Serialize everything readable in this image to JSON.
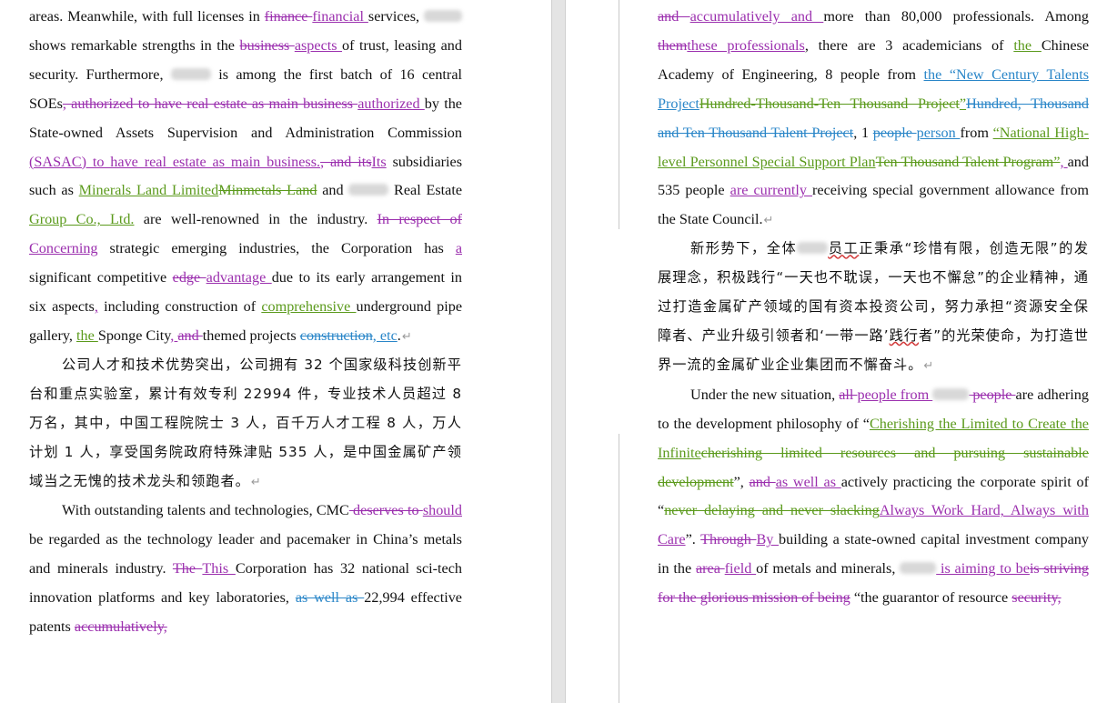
{
  "left": {
    "p1": {
      "s1": "areas. Meanwhile, with full licenses in ",
      "del1": "finance ",
      "ins1": "financial ",
      "s2": "services, ",
      "s3": " shows remarkable strengths in the ",
      "del2": "business ",
      "ins2": "aspects ",
      "s4": "of trust, leasing and security. Furthermore, ",
      "s5": " is among the first batch of 16 central SOEs",
      "del3": ", authorized to have real estate as main business ",
      "ins3": "authorized ",
      "s6": "by the State-owned Assets Supervision and Administration Commission",
      "ins4": " (SASAC) to have real estate as main business.",
      "del4": ", and its",
      "ins5": "Its",
      "s7": " subsidiaries such as ",
      "ins6": "Minerals Land Limited",
      "del5": "Minmetals Land",
      "s8": " and ",
      "s9": " Real Estate ",
      "ins7": "Group Co., Ltd.",
      "s10": " are well-renowned in the industry. ",
      "del6": "In respect of ",
      "ins8": "Concerning",
      "s11": " strategic emerging industries, the Corporation has ",
      "ins9": "a ",
      "s12": "significant competitive ",
      "del7": "edge ",
      "ins10": "advantage ",
      "s13": "due to its early arrangement in six aspects",
      "ins11": ",",
      "s14": " including construction of ",
      "ins12": "comprehensive ",
      "s15": "underground pipe gallery, ",
      "ins13": "the ",
      "s16": " Sponge City",
      "ins14": ", ",
      "del8": " and ",
      "s17": "themed projects ",
      "del9": "construction",
      "ins15": ", etc",
      "s18": "."
    },
    "p2": "公司人才和技术优势突出，公司拥有 32 个国家级科技创新平台和重点实验室，累计有效专利 22994 件，专业技术人员超过 8 万名，其中，中国工程院院士 3 人，百千万人才工程 8 人，万人计划 1 人，享受国务院政府特殊津贴 535 人，是中国金属矿产领域当之无愧的技术龙头和领跑者。",
    "p3": {
      "s1": "With outstanding talents and technologies, CMC",
      "del1": " deserves to ",
      "ins1": " should ",
      "s2": "be regarded as the technology leader and pacemaker in China’s metals and minerals industry. ",
      "del2": "The ",
      "ins2": "This ",
      "s3": "Corporation has 32 national sci-tech innovation platforms and key laboratories, ",
      "del3": "as well as ",
      "s4": "22,994 effective patents ",
      "del4": "accumulatively, "
    }
  },
  "right": {
    "p1": {
      "del1": "and ",
      "ins1": "accumulatively and ",
      "s1": "more than 80,000 professionals. Among ",
      "del2": "them",
      "ins2": "these professionals",
      "s2": ", there are 3 academicians of ",
      "ins3": "the ",
      "s3": "Chinese Academy of Engineering, 8 people from ",
      "ins4": "the “New Century Talents Project",
      "del3": "Hundred-Thousand-Ten Thousand Project",
      "ins5": "”",
      "del4": "Hundred, Thousand and Ten Thousand Talent Project",
      "s4": ", 1 ",
      "del5": "people ",
      "ins6": "person ",
      "s5": "from ",
      "ins7": "“National High-level Personnel Special Support Plan",
      "del6": "Ten Thousand Talent Program”",
      "ins8": ", ",
      "s6": "and 535 people ",
      "ins9": "are currently ",
      "s7": "receiving special government allowance from the State Council."
    },
    "p2": {
      "s1": "新形势下，全体",
      "s2": "员工",
      "s3": "正秉承“珍惜有限，创造无限”的发展理念，积极践行“一天也不耽误，一天也不懈怠”的企业精神，通过打造金属矿产领域的国有资本投资公司，努力承担“资源安全保障者、产业升级引领者和‘一带一路’",
      "s4": "践行",
      "s5": "者”的光荣使命，为打造世界一流的金属矿业企业集团而不懈奋斗。"
    },
    "p3": {
      "s1": "Under the new situation, ",
      "del1": "all ",
      "ins1": "people from ",
      "del2": " people ",
      "s2": "are adhering to the development philosophy of “",
      "ins2": "Cherishing the Limited to Create the Infinite",
      "del3": "cherishing limited resources and pursuing sustainable development",
      "s3": "”, ",
      "del4": "and ",
      "ins3": "as well as ",
      "s4": "actively practicing the corporate spirit of “",
      "del5": "never delaying and never slacking",
      "ins4": "Always Work Hard, Always with Care",
      "s5": "”. ",
      "del6": "Through ",
      "ins5": "By ",
      "s6": "building a state-owned capital investment company in the ",
      "del7": "area ",
      "ins6": "field ",
      "s7": "of metals and minerals, ",
      "ins7": " is aiming to be",
      "del8": "is striving for the glorious mission of being",
      "s8": " “the guarantor of resource ",
      "del9": "security, "
    }
  },
  "marks": {
    "paragraph": "↵"
  },
  "colors": {
    "reviewer_purple": "#9b2fae",
    "reviewer_green": "#5b9a1c",
    "reviewer_blue": "#2a86c8",
    "page_bg": "#ffffff",
    "gutter": "#e4e4e4"
  }
}
